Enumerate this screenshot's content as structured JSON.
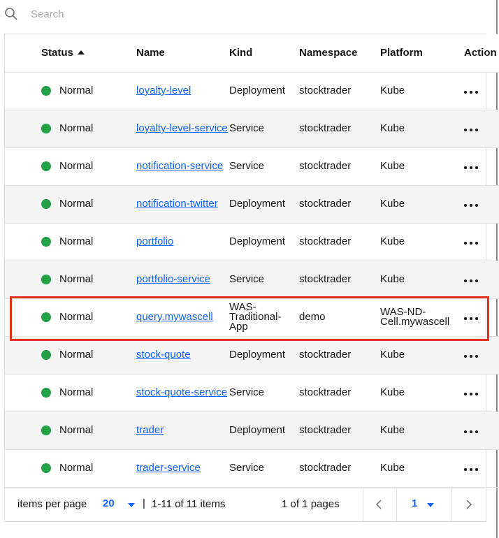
{
  "search": {
    "placeholder": "Search"
  },
  "table": {
    "headers": {
      "status": "Status",
      "name": "Name",
      "kind": "Kind",
      "namespace": "Namespace",
      "platform": "Platform",
      "action": "Action"
    },
    "sort": {
      "column": "status",
      "direction": "ascending"
    },
    "status_color": "#24a148",
    "rows": [
      {
        "status": "Normal",
        "name": "loyalty-level",
        "kind": "Deployment",
        "namespace": "stocktrader",
        "platform": "Kube"
      },
      {
        "status": "Normal",
        "name": "loyalty-level-service",
        "kind": "Service",
        "namespace": "stocktrader",
        "platform": "Kube"
      },
      {
        "status": "Normal",
        "name": "notification-service",
        "kind": "Service",
        "namespace": "stocktrader",
        "platform": "Kube"
      },
      {
        "status": "Normal",
        "name": "notification-twitter",
        "kind": "Deployment",
        "namespace": "stocktrader",
        "platform": "Kube"
      },
      {
        "status": "Normal",
        "name": "portfolio",
        "kind": "Deployment",
        "namespace": "stocktrader",
        "platform": "Kube"
      },
      {
        "status": "Normal",
        "name": "portfolio-service",
        "kind": "Service",
        "namespace": "stocktrader",
        "platform": "Kube"
      },
      {
        "status": "Normal",
        "name": "query.mywascell",
        "kind": "WAS-Traditional-App",
        "namespace": "demo",
        "platform": "WAS-ND-Cell.mywascell",
        "highlighted": true
      },
      {
        "status": "Normal",
        "name": "stock-quote",
        "kind": "Deployment",
        "namespace": "stocktrader",
        "platform": "Kube"
      },
      {
        "status": "Normal",
        "name": "stock-quote-service",
        "kind": "Service",
        "namespace": "stocktrader",
        "platform": "Kube"
      },
      {
        "status": "Normal",
        "name": "trader",
        "kind": "Deployment",
        "namespace": "stocktrader",
        "platform": "Kube"
      },
      {
        "status": "Normal",
        "name": "trader-service",
        "kind": "Service",
        "namespace": "stocktrader",
        "platform": "Kube"
      }
    ]
  },
  "pagination": {
    "items_per_page_label": "items per page",
    "items_per_page_value": "20",
    "separator": "|",
    "range_text": "1-11 of 11 items",
    "pages_text": "1 of 1 pages",
    "current_page": "1"
  },
  "colors": {
    "accent": "#0f62fe",
    "highlight_border": "#e5321d",
    "row_alt": "#f4f4f4"
  },
  "icons": {
    "search": "search-icon",
    "row_action": "overflow-menu-icon",
    "prev": "chevron-left-icon",
    "next": "chevron-right-icon"
  }
}
